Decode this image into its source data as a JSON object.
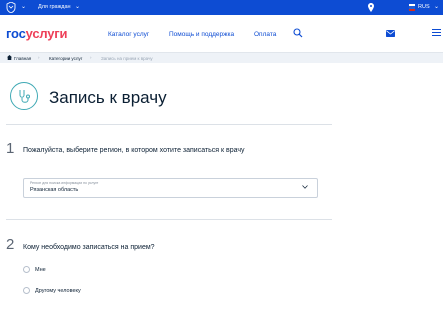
{
  "colors": {
    "brand_blue": "#0d4cd3",
    "brand_red": "#ee3f58",
    "accent_teal": "#3fa9b4"
  },
  "topbar": {
    "citizen_selector": "Для граждан",
    "language": "RUS"
  },
  "header": {
    "logo_part1": "гос",
    "logo_part2": "услуги",
    "nav": [
      "Каталог услуг",
      "Помощь и поддержка",
      "Оплата"
    ]
  },
  "breadcrumbs": [
    "Главная",
    "Категории услуг",
    "Запись на прием к врачу"
  ],
  "page": {
    "title": "Запись к врачу",
    "icon": "stethoscope-icon"
  },
  "steps": [
    {
      "number": "1",
      "question": "Пожалуйста, выберите регион, в котором хотите записаться к врачу",
      "select": {
        "label": "Регион для поиска информации по услуге",
        "value": "Рязанская область"
      }
    },
    {
      "number": "2",
      "question": "Кому необходимо записаться на прием?",
      "options": [
        "Мне",
        "Другому человеку"
      ]
    }
  ]
}
